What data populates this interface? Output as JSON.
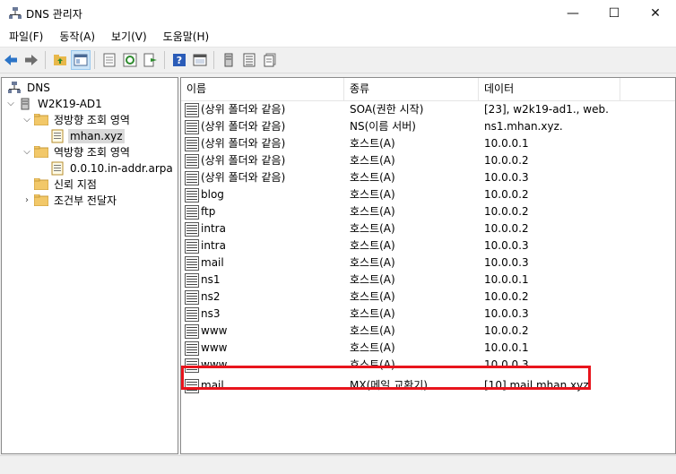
{
  "window": {
    "title": "DNS 관리자",
    "min": "—",
    "max": "☐",
    "close": "✕"
  },
  "menu": [
    "파일(F)",
    "동작(A)",
    "보기(V)",
    "도움말(H)"
  ],
  "tree": {
    "root": "DNS",
    "server": "W2K19-AD1",
    "forward": "정방향 조회 영역",
    "zone": "mhan.xyz",
    "reverse": "역방향 조회 영역",
    "rzone": "0.0.10.in-addr.arpa",
    "trust": "신뢰 지점",
    "cond": "조건부 전달자"
  },
  "columns": [
    "이름",
    "종류",
    "데이터"
  ],
  "records": [
    {
      "name": "(상위 폴더와 같음)",
      "type": "SOA(권한 시작)",
      "data": "[23], w2k19-ad1., web."
    },
    {
      "name": "(상위 폴더와 같음)",
      "type": "NS(이름 서버)",
      "data": "ns1.mhan.xyz."
    },
    {
      "name": "(상위 폴더와 같음)",
      "type": "호스트(A)",
      "data": "10.0.0.1"
    },
    {
      "name": "(상위 폴더와 같음)",
      "type": "호스트(A)",
      "data": "10.0.0.2"
    },
    {
      "name": "(상위 폴더와 같음)",
      "type": "호스트(A)",
      "data": "10.0.0.3"
    },
    {
      "name": "blog",
      "type": "호스트(A)",
      "data": "10.0.0.2"
    },
    {
      "name": "ftp",
      "type": "호스트(A)",
      "data": "10.0.0.2"
    },
    {
      "name": "intra",
      "type": "호스트(A)",
      "data": "10.0.0.2"
    },
    {
      "name": "intra",
      "type": "호스트(A)",
      "data": "10.0.0.3"
    },
    {
      "name": "mail",
      "type": "호스트(A)",
      "data": "10.0.0.3"
    },
    {
      "name": "ns1",
      "type": "호스트(A)",
      "data": "10.0.0.1"
    },
    {
      "name": "ns2",
      "type": "호스트(A)",
      "data": "10.0.0.2"
    },
    {
      "name": "ns3",
      "type": "호스트(A)",
      "data": "10.0.0.3"
    },
    {
      "name": "www",
      "type": "호스트(A)",
      "data": "10.0.0.2"
    },
    {
      "name": "www",
      "type": "호스트(A)",
      "data": "10.0.0.1"
    },
    {
      "name": "www",
      "type": "호스트(A)",
      "data": "10.0.0.3"
    },
    {
      "name": "mail",
      "type": "MX(메일 교환기)",
      "data": "[10]  mail.mhan.xyz"
    }
  ],
  "highlight_color": "#e8141c",
  "icons": [
    "back-icon",
    "forward-icon",
    "up-folder-icon",
    "console-tree-icon",
    "export-icon",
    "refresh-icon",
    "export-list-icon",
    "help-icon",
    "properties-icon",
    "server-icon",
    "zone-list-icon",
    "records-icon"
  ]
}
